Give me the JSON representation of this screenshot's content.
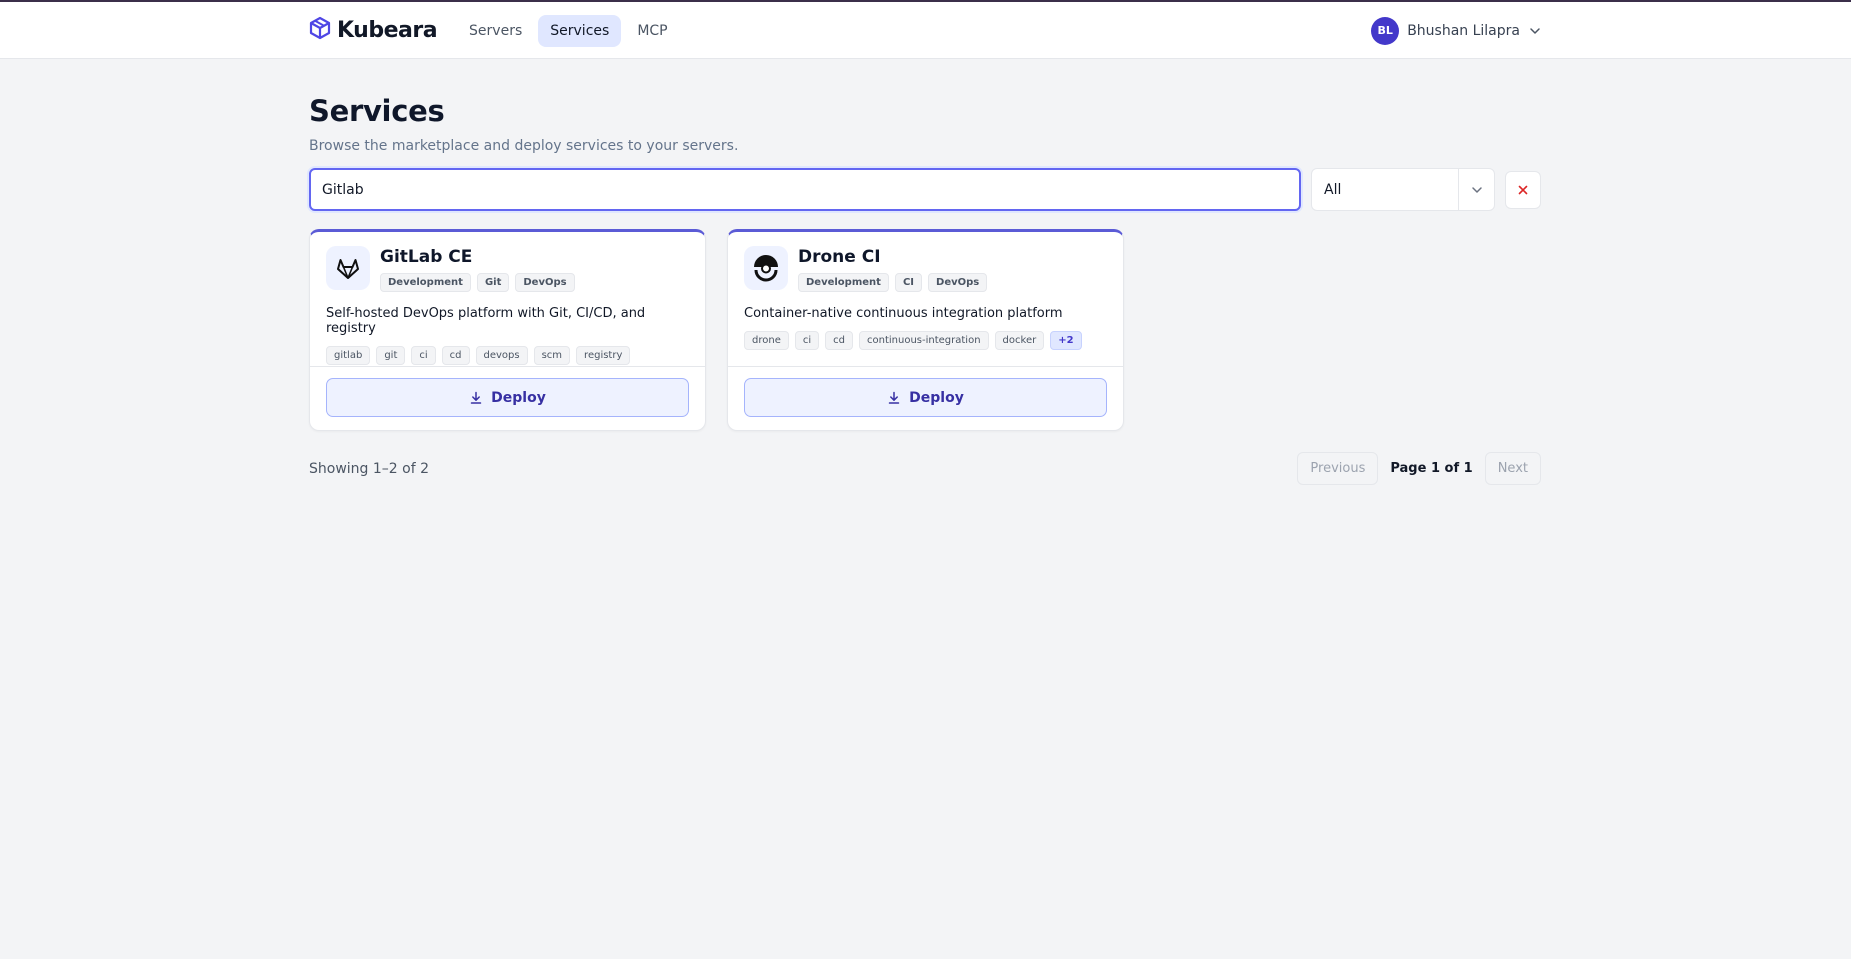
{
  "header": {
    "brand": "Kubeara",
    "nav": [
      {
        "label": "Servers",
        "active": false
      },
      {
        "label": "Services",
        "active": true
      },
      {
        "label": "MCP",
        "active": false
      }
    ],
    "user": {
      "initials": "BL",
      "name": "Bhushan Lilapra"
    }
  },
  "page": {
    "title": "Services",
    "subtitle": "Browse the marketplace and deploy services to your servers."
  },
  "filters": {
    "search_value": "Gitlab",
    "category_selected": "All"
  },
  "cards": [
    {
      "title": "GitLab CE",
      "icon": "gitlab-icon",
      "categories": [
        "Development",
        "Git",
        "DevOps"
      ],
      "description": "Self-hosted DevOps platform with Git, CI/CD, and registry",
      "tags": [
        "gitlab",
        "git",
        "ci",
        "cd",
        "devops",
        "scm",
        "registry"
      ],
      "more": "",
      "deploy_label": "Deploy"
    },
    {
      "title": "Drone CI",
      "icon": "drone-icon",
      "categories": [
        "Development",
        "CI",
        "DevOps"
      ],
      "description": "Container-native continuous integration platform",
      "tags": [
        "drone",
        "ci",
        "cd",
        "continuous-integration",
        "docker"
      ],
      "more": "+2",
      "deploy_label": "Deploy"
    }
  ],
  "pagination": {
    "showing": "Showing 1–2 of 2",
    "previous": "Previous",
    "page_label": "Page 1 of 1",
    "next": "Next"
  },
  "colors": {
    "accent": "#5b5bd6",
    "avatar": "#4338ca",
    "clear": "#dc2626"
  }
}
